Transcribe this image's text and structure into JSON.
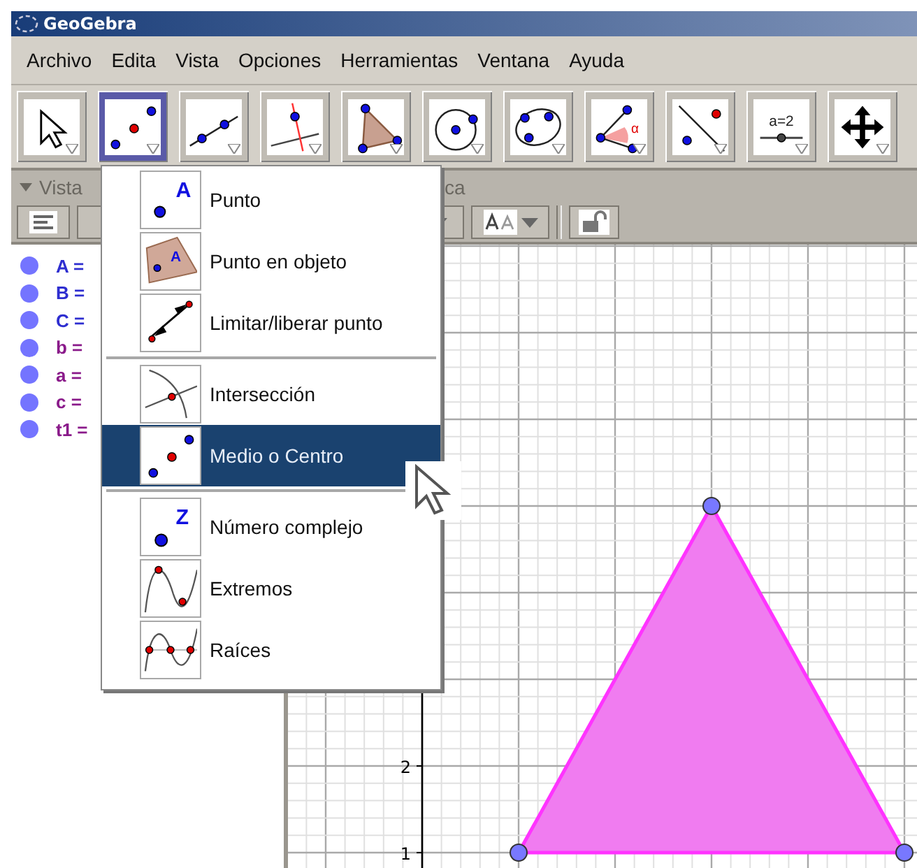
{
  "window": {
    "title": "GeoGebra"
  },
  "menu": [
    "Archivo",
    "Edita",
    "Vista",
    "Opciones",
    "Herramientas",
    "Ventana",
    "Ayuda"
  ],
  "toolbar": [
    {
      "kind": "move",
      "selected": false
    },
    {
      "kind": "midpoint",
      "selected": true
    },
    {
      "kind": "line",
      "selected": false
    },
    {
      "kind": "perpendicular",
      "selected": false
    },
    {
      "kind": "polygon",
      "selected": false
    },
    {
      "kind": "circle",
      "selected": false
    },
    {
      "kind": "conic",
      "selected": false
    },
    {
      "kind": "angle",
      "icon_text": "α",
      "selected": false
    },
    {
      "kind": "reflect",
      "selected": false
    },
    {
      "kind": "slider",
      "icon_text": "a=2",
      "selected": false
    },
    {
      "kind": "move_view",
      "selected": false
    }
  ],
  "algebra_view": {
    "header": "Vista",
    "objects": [
      {
        "label": "A =",
        "color": "#2e2ed0"
      },
      {
        "label": "B =",
        "color": "#2e2ed0"
      },
      {
        "label": "C =",
        "color": "#2e2ed0"
      },
      {
        "label": "b =",
        "color": "#8a1a8a"
      },
      {
        "label": "a =",
        "color": "#8a1a8a"
      },
      {
        "label": "c =",
        "color": "#8a1a8a"
      },
      {
        "label": "t1 =",
        "color": "#8a1a8a"
      }
    ]
  },
  "graphics_view": {
    "header": "ca",
    "y_ticks": [
      "2",
      "1"
    ]
  },
  "tool_menu": {
    "groups": [
      [
        {
          "kind": "point",
          "icon_text": "A",
          "label": "Punto",
          "selected": false
        },
        {
          "kind": "point_on_object",
          "icon_text": "A",
          "label": "Punto en objeto",
          "selected": false
        },
        {
          "kind": "attach_detach",
          "label": "Limitar/liberar punto",
          "selected": false
        }
      ],
      [
        {
          "kind": "intersect",
          "label": "Intersección",
          "selected": false
        },
        {
          "kind": "midpoint",
          "label": "Medio o Centro",
          "selected": true
        }
      ],
      [
        {
          "kind": "complex",
          "icon_text": "Z",
          "label": "Número complejo",
          "selected": false
        },
        {
          "kind": "extremum",
          "label": "Extremos",
          "selected": false
        },
        {
          "kind": "roots",
          "label": "Raíces",
          "selected": false
        }
      ]
    ]
  }
}
